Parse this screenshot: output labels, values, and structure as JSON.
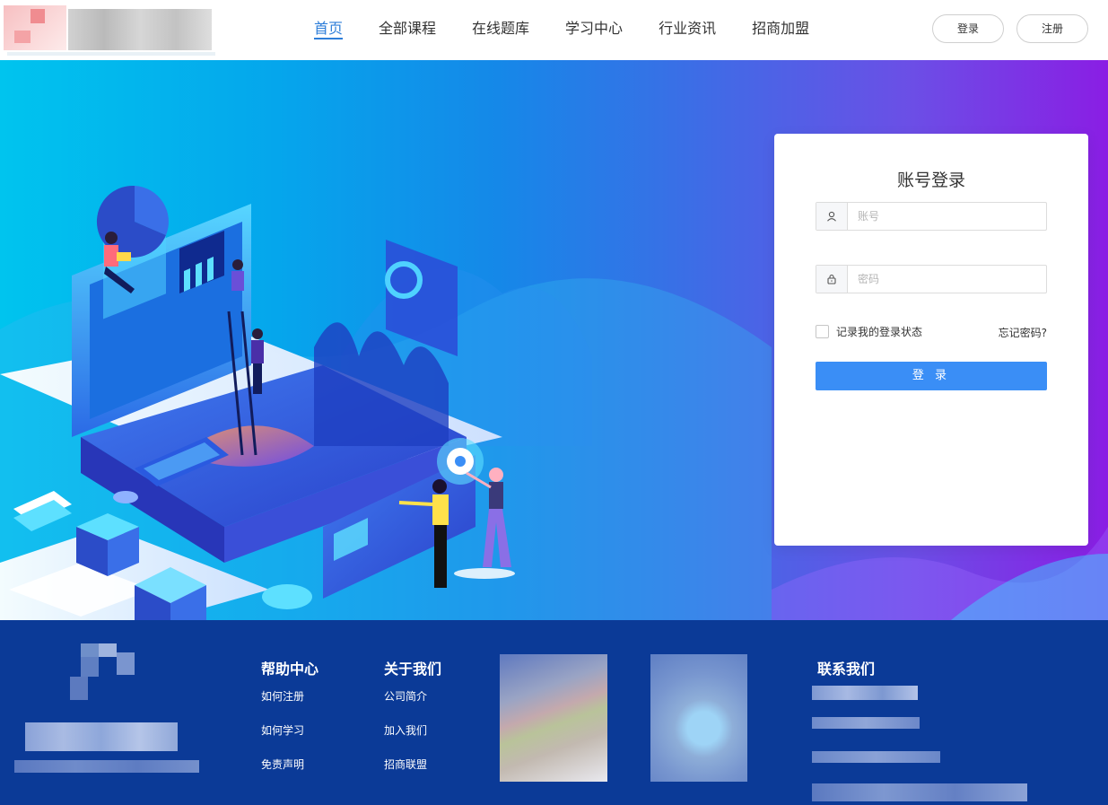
{
  "header": {
    "nav": [
      "首页",
      "全部课程",
      "在线题库",
      "学习中心",
      "行业资讯",
      "招商加盟"
    ],
    "active_index": 0,
    "login_button": "登录",
    "register_button": "注册"
  },
  "login": {
    "title": "账号登录",
    "account_placeholder": "账号",
    "password_placeholder": "密码",
    "remember_label": "记录我的登录状态",
    "forgot_label": "忘记密码?",
    "submit_label": "登 录"
  },
  "footer": {
    "help": {
      "title": "帮助中心",
      "links": [
        "如何注册",
        "如何学习",
        "免责声明"
      ]
    },
    "about": {
      "title": "关于我们",
      "links": [
        "公司简介",
        "加入我们",
        "招商联盟"
      ]
    },
    "contact": {
      "title": "联系我们"
    }
  },
  "colors": {
    "accent": "#3a8ef6",
    "nav_active": "#2e7ed9",
    "footer_bg": "#0b3a97"
  },
  "icons": [
    "user-icon",
    "lock-icon",
    "checkbox"
  ]
}
